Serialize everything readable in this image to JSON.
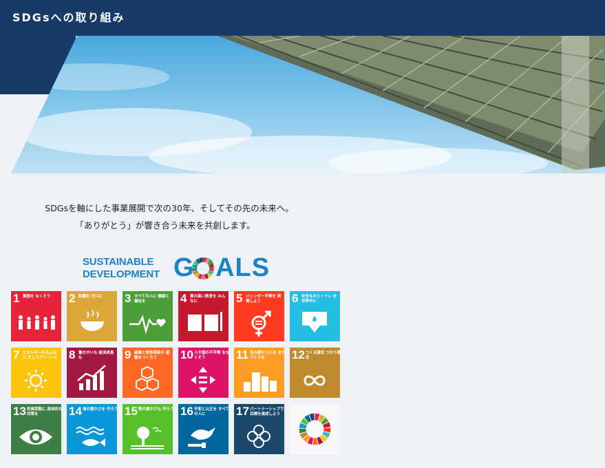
{
  "header": {
    "title": "SDGsへの取り組み"
  },
  "intro": {
    "line1": "SDGsを軸にした事業展開で次の30年、そしてその先の未来へ。",
    "line2": "「ありがとう」が響き合う未来を共創します。"
  },
  "sdg_logo": {
    "line1": "SUSTAINABLE",
    "line2": "DEVELOPMENT",
    "goals_word": "GOALS"
  },
  "goals": [
    {
      "num": "1",
      "label": "貧困を なくそう",
      "color": "#e5243b",
      "icon": "family-icon"
    },
    {
      "num": "2",
      "label": "飢餓を ゼロに",
      "color": "#dda63a",
      "icon": "bowl-icon"
    },
    {
      "num": "3",
      "label": "すべての人に 健康と福祉を",
      "color": "#4c9f38",
      "icon": "heartbeat-icon"
    },
    {
      "num": "4",
      "label": "質の高い教育を みんなに",
      "color": "#c5192d",
      "icon": "book-icon"
    },
    {
      "num": "5",
      "label": "ジェンダー平等を 実現しよう",
      "color": "#ff3a21",
      "icon": "gender-icon"
    },
    {
      "num": "6",
      "label": "安全な水とトイレ を世界中に",
      "color": "#26bde2",
      "icon": "water-icon"
    },
    {
      "num": "7",
      "label": "エネルギーをみんなに そしてクリーンに",
      "color": "#fcc30b",
      "icon": "sun-icon"
    },
    {
      "num": "8",
      "label": "働きがいも 経済成長も",
      "color": "#a21942",
      "icon": "growth-chart-icon"
    },
    {
      "num": "9",
      "label": "産業と技術革新の 基盤をつくろう",
      "color": "#fd6925",
      "icon": "cubes-icon"
    },
    {
      "num": "10",
      "label": "人や国の不平等 をなくそう",
      "color": "#dd1367",
      "icon": "equality-icon"
    },
    {
      "num": "11",
      "label": "住み続けられる まちづくりを",
      "color": "#fd9d24",
      "icon": "city-icon"
    },
    {
      "num": "12",
      "label": "つくる責任 つかう責任",
      "color": "#bf8b2e",
      "icon": "infinity-icon"
    },
    {
      "num": "13",
      "label": "気候変動に 具体的な対策を",
      "color": "#3f7e44",
      "icon": "eye-globe-icon"
    },
    {
      "num": "14",
      "label": "海の豊かさを 守ろう",
      "color": "#0a97d9",
      "icon": "fish-icon"
    },
    {
      "num": "15",
      "label": "陸の豊かさも 守ろう",
      "color": "#56c02b",
      "icon": "tree-icon"
    },
    {
      "num": "16",
      "label": "平和と公正を すべての人に",
      "color": "#00689d",
      "icon": "dove-icon"
    },
    {
      "num": "17",
      "label": "パートナーシップで 目標を達成しよう",
      "color": "#19486a",
      "icon": "rings-icon"
    }
  ],
  "wheel_tile": {
    "icon": "sdg-wheel-icon"
  },
  "colors": {
    "header_navy": "#173a66",
    "background": "#eef2f6",
    "logo_blue": "#1c83c6"
  }
}
